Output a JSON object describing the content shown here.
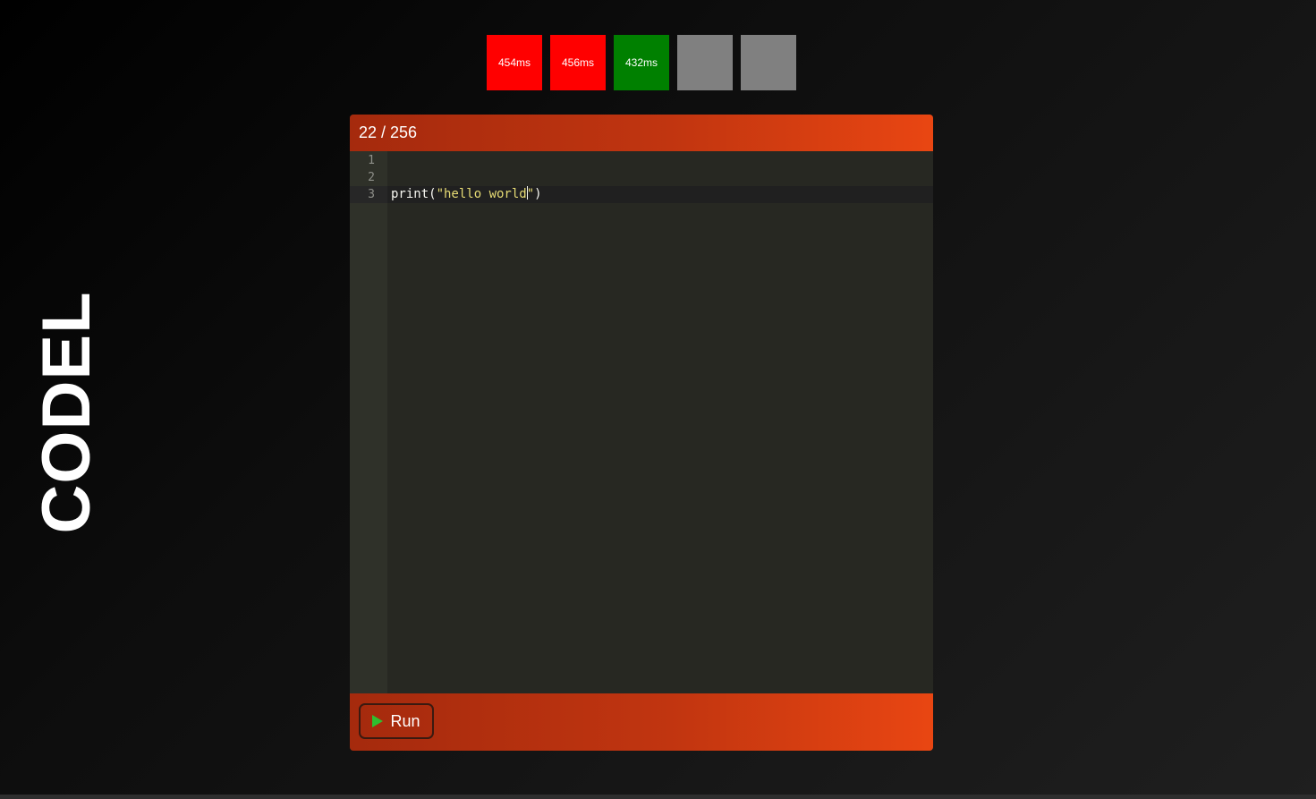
{
  "app": {
    "title": "CODEL"
  },
  "attempts": [
    {
      "label": "454ms",
      "status": "fail",
      "color": "#ff0000"
    },
    {
      "label": "456ms",
      "status": "fail",
      "color": "#ff0000"
    },
    {
      "label": "432ms",
      "status": "pass",
      "color": "#008000"
    },
    {
      "label": "",
      "status": "empty",
      "color": "#808080"
    },
    {
      "label": "",
      "status": "empty",
      "color": "#808080"
    }
  ],
  "editor": {
    "char_count": "22 / 256",
    "line_numbers": [
      "1",
      "2",
      "3"
    ],
    "lines": [
      {
        "tokens": []
      },
      {
        "tokens": []
      },
      {
        "tokens": [
          {
            "text": "print(",
            "kind": "plain"
          },
          {
            "text": "\"hello world",
            "kind": "string"
          },
          {
            "text": "\"",
            "kind": "string"
          },
          {
            "text": ")",
            "kind": "plain"
          }
        ]
      }
    ],
    "active_line": 3
  },
  "footer": {
    "run_label": "Run",
    "run_icon": "play-icon"
  },
  "colors": {
    "header_gradient_start": "#a52a0d",
    "header_gradient_end": "#e94612",
    "editor_bg": "#272822",
    "string_color": "#e6db74",
    "play_icon_color": "#2fbf2f"
  }
}
